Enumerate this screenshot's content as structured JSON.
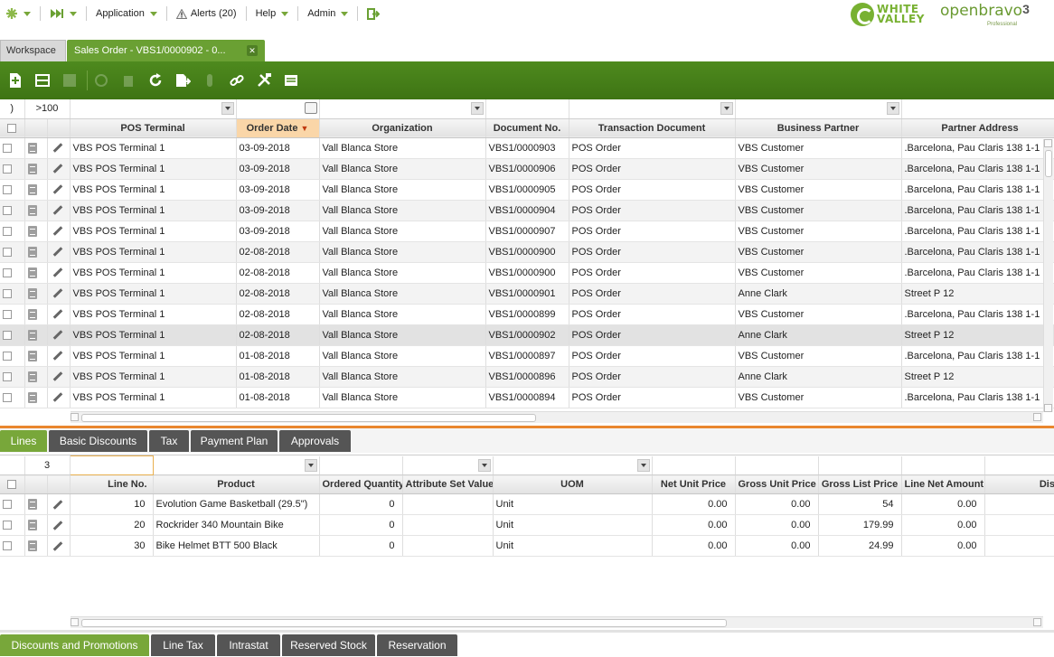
{
  "nav": {
    "application": "Application",
    "alerts": "Alerts (20)",
    "help": "Help",
    "admin": "Admin"
  },
  "logos": {
    "white_valley_1": "WHITE",
    "white_valley_2": "VALLEY",
    "openbravo": "openbravo",
    "version": "3",
    "edition": "Professional"
  },
  "tabs": {
    "workspace": "Workspace",
    "sales_order": "Sales Order - VBS1/0000902 - 0..."
  },
  "colors": {
    "brand_green": "#78a73a",
    "toolbar_green": "#4e8a1e",
    "sorted_header": "#fad6a8"
  },
  "orders": {
    "count": ">100",
    "columns": [
      "POS Terminal",
      "Order Date",
      "Organization",
      "Document No.",
      "Transaction Document",
      "Business Partner",
      "Partner Address"
    ],
    "sort_indicator": "▼",
    "rows": [
      [
        "VBS POS Terminal 1",
        "03-09-2018",
        "Vall Blanca Store",
        "VBS1/0000903",
        "POS Order",
        "VBS Customer",
        ".Barcelona, Pau Claris 138 1-1"
      ],
      [
        "VBS POS Terminal 1",
        "03-09-2018",
        "Vall Blanca Store",
        "VBS1/0000906",
        "POS Order",
        "VBS Customer",
        ".Barcelona, Pau Claris 138 1-1"
      ],
      [
        "VBS POS Terminal 1",
        "03-09-2018",
        "Vall Blanca Store",
        "VBS1/0000905",
        "POS Order",
        "VBS Customer",
        ".Barcelona, Pau Claris 138 1-1"
      ],
      [
        "VBS POS Terminal 1",
        "03-09-2018",
        "Vall Blanca Store",
        "VBS1/0000904",
        "POS Order",
        "VBS Customer",
        ".Barcelona, Pau Claris 138 1-1"
      ],
      [
        "VBS POS Terminal 1",
        "03-09-2018",
        "Vall Blanca Store",
        "VBS1/0000907",
        "POS Order",
        "VBS Customer",
        ".Barcelona, Pau Claris 138 1-1"
      ],
      [
        "VBS POS Terminal 1",
        "02-08-2018",
        "Vall Blanca Store",
        "VBS1/0000900",
        "POS Order",
        "VBS Customer",
        ".Barcelona, Pau Claris 138 1-1"
      ],
      [
        "VBS POS Terminal 1",
        "02-08-2018",
        "Vall Blanca Store",
        "VBS1/0000900",
        "POS Order",
        "VBS Customer",
        ".Barcelona, Pau Claris 138 1-1"
      ],
      [
        "VBS POS Terminal 1",
        "02-08-2018",
        "Vall Blanca Store",
        "VBS1/0000901",
        "POS Order",
        "Anne Clark",
        "Street P 12"
      ],
      [
        "VBS POS Terminal 1",
        "02-08-2018",
        "Vall Blanca Store",
        "VBS1/0000899",
        "POS Order",
        "VBS Customer",
        ".Barcelona, Pau Claris 138 1-1"
      ],
      [
        "VBS POS Terminal 1",
        "02-08-2018",
        "Vall Blanca Store",
        "VBS1/0000902",
        "POS Order",
        "Anne Clark",
        "Street P 12"
      ],
      [
        "VBS POS Terminal 1",
        "01-08-2018",
        "Vall Blanca Store",
        "VBS1/0000897",
        "POS Order",
        "VBS Customer",
        ".Barcelona, Pau Claris 138 1-1"
      ],
      [
        "VBS POS Terminal 1",
        "01-08-2018",
        "Vall Blanca Store",
        "VBS1/0000896",
        "POS Order",
        "Anne Clark",
        "Street P 12"
      ],
      [
        "VBS POS Terminal 1",
        "01-08-2018",
        "Vall Blanca Store",
        "VBS1/0000894",
        "POS Order",
        "VBS Customer",
        ".Barcelona, Pau Claris 138 1-1"
      ]
    ],
    "selected_row": 9
  },
  "detail_tabs": [
    "Lines",
    "Basic Discounts",
    "Tax",
    "Payment Plan",
    "Approvals"
  ],
  "lines": {
    "count": "3",
    "columns": [
      "Line No.",
      "Product",
      "Ordered Quantity",
      "Attribute Set Value",
      "UOM",
      "Net Unit Price",
      "Gross Unit Price",
      "Gross List Price",
      "Line Net Amount",
      "Discou"
    ],
    "rows": [
      [
        "10",
        "Evolution Game Basketball (29.5\")",
        "0",
        "",
        "Unit",
        "0.00",
        "0.00",
        "54",
        "0.00",
        ""
      ],
      [
        "20",
        "Rockrider 340 Mountain Bike",
        "0",
        "",
        "Unit",
        "0.00",
        "0.00",
        "179.99",
        "0.00",
        ""
      ],
      [
        "30",
        "Bike Helmet BTT 500 Black",
        "0",
        "",
        "Unit",
        "0.00",
        "0.00",
        "24.99",
        "0.00",
        ""
      ]
    ]
  },
  "bottom_tabs": [
    "Discounts and Promotions",
    "Line Tax",
    "Intrastat",
    "Reserved Stock",
    "Reservation"
  ]
}
